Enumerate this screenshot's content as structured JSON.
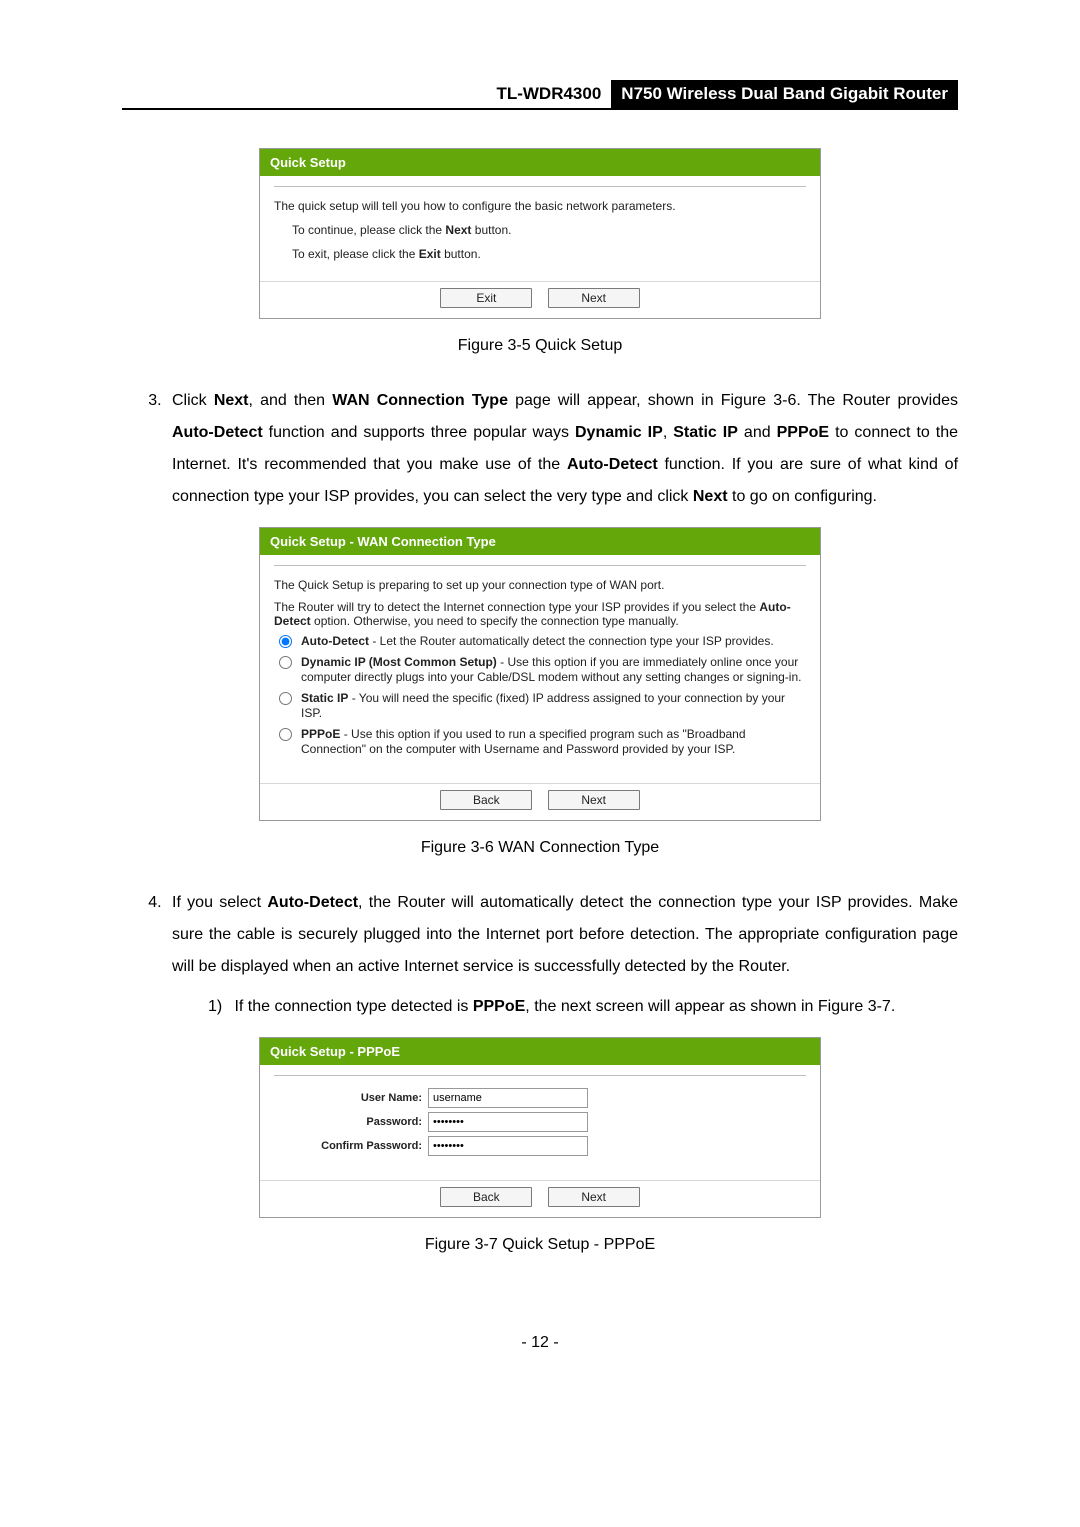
{
  "header": {
    "model": "TL-WDR4300",
    "product": "N750 Wireless Dual Band Gigabit Router"
  },
  "panel1": {
    "title": "Quick Setup",
    "line1": "The quick setup will tell you how to configure the basic network parameters.",
    "line2a": "To continue, please click the ",
    "line2b_bold": "Next",
    "line2c": " button.",
    "line3a": "To exit, please click the ",
    "line3b_bold": "Exit",
    "line3c": " button.",
    "btn_exit": "Exit",
    "btn_next": "Next"
  },
  "fig1": "Figure 3-5 Quick Setup",
  "step3": {
    "a": "Click ",
    "b": "Next",
    "c": ", and then ",
    "d": "WAN Connection Type",
    "e": " page will appear, shown in Figure 3-6. The Router provides ",
    "f": "Auto-Detect",
    "g": " function and supports three popular ways ",
    "h": "Dynamic IP",
    "i": ", ",
    "j": "Static IP",
    "k": " and ",
    "l": "PPPoE",
    "m": " to connect to the Internet. It's recommended that you make use of the ",
    "n": "Auto-Detect",
    "o": " function. If you are sure of what kind of connection type your ISP provides, you can select the very type and click ",
    "p": "Next",
    "q": " to go on configuring."
  },
  "panel2": {
    "title": "Quick Setup - WAN Connection Type",
    "intro1": "The Quick Setup is preparing to set up your connection type of WAN port.",
    "intro2a": "The Router will try to detect the Internet connection type your ISP provides if you select the ",
    "intro2b_bold": "Auto-Detect",
    "intro2c": " option. Otherwise, you need to specify the connection type manually.",
    "opt1_b": "Auto-Detect",
    "opt1_t": " - Let the Router automatically detect the connection type your ISP provides.",
    "opt2_b": "Dynamic IP (Most Common Setup)",
    "opt2_t": " - Use this option if you are immediately online once your computer directly plugs into your Cable/DSL modem without any setting changes or signing-in.",
    "opt3_b": "Static IP",
    "opt3_t": " - You will need the specific (fixed) IP address assigned to your connection by your ISP.",
    "opt4_b": "PPPoE",
    "opt4_t": " - Use this option if you used to run a specified program such as \"Broadband Connection\" on the computer with Username and Password provided by your ISP.",
    "btn_back": "Back",
    "btn_next": "Next"
  },
  "fig2": "Figure 3-6 WAN Connection Type",
  "step4": {
    "a": "If you select ",
    "b": "Auto-Detect",
    "c": ", the Router will automatically detect the connection type your ISP provides. Make sure the cable is securely plugged into the Internet port before detection. The appropriate configuration page will be displayed when an active Internet service is successfully detected by the Router."
  },
  "step4_1": {
    "marker": "1)",
    "a": "If the connection type detected is ",
    "b": "PPPoE",
    "c": ", the next screen will appear as shown in Figure 3-7."
  },
  "panel3": {
    "title": "Quick Setup - PPPoE",
    "lbl_user": "User Name:",
    "val_user": "username",
    "lbl_pass": "Password:",
    "val_pass": "••••••••",
    "lbl_conf": "Confirm Password:",
    "val_conf": "••••••••",
    "btn_back": "Back",
    "btn_next": "Next"
  },
  "fig3": "Figure 3-7 Quick Setup - PPPoE",
  "page_num": "- 12 -"
}
